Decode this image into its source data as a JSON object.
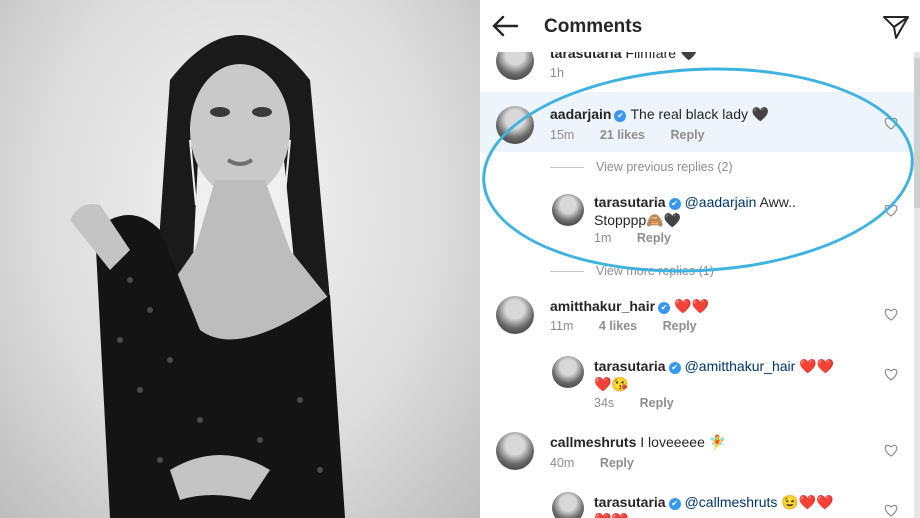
{
  "header": {
    "title": "Comments"
  },
  "comments": [
    {
      "user": "tarasutaria",
      "text": "Filmfare",
      "emoji": "🖤",
      "time": "1h"
    },
    {
      "user": "aadarjain",
      "text": "The real black lady",
      "emoji": "🖤",
      "time": "15m",
      "likes": "21 likes",
      "reply": "Reply"
    },
    {
      "user": "amitthakur_hair",
      "text": "",
      "emoji": "❤️❤️",
      "time": "11m",
      "likes": "4 likes",
      "reply": "Reply"
    },
    {
      "user": "callmeshruts",
      "text": "I loveeeee",
      "emoji": "🧚",
      "time": "40m",
      "reply": "Reply"
    }
  ],
  "replies": [
    {
      "user": "tarasutaria",
      "mention": "@aadarjain",
      "text1": "Aww..",
      "text2": "Stopppp",
      "emoji": "🙈🖤",
      "time": "1m",
      "reply": "Reply"
    },
    {
      "user": "tarasutaria",
      "mention": "@amitthakur_hair",
      "emoji1": "❤️❤️",
      "emoji2": "❤️😘",
      "time": "34s",
      "reply": "Reply"
    },
    {
      "user": "tarasutaria",
      "mention": "@callmeshruts",
      "emoji1": "😉❤️❤️",
      "emoji2": "❤️❤️"
    }
  ],
  "threads": {
    "view_previous": "View previous replies (2)",
    "view_more": "View more replies (1)"
  },
  "colors": {
    "verified": "#3897f0",
    "highlight_circle": "#3fb3e0",
    "row_highlight": "#eef4fb"
  }
}
